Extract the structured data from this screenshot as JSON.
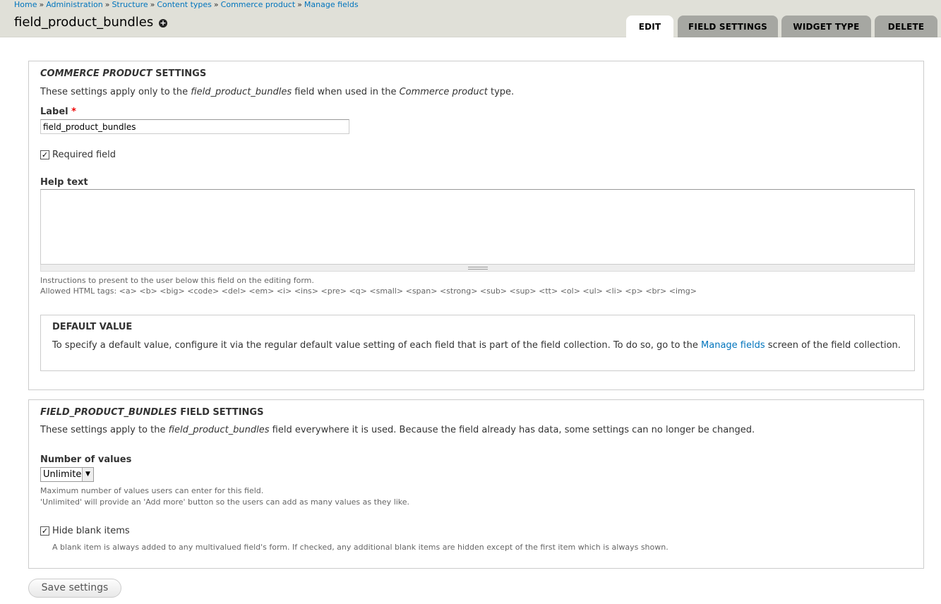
{
  "breadcrumb": [
    "Home",
    "Administration",
    "Structure",
    "Content types",
    "Commerce product",
    "Manage fields"
  ],
  "breadcrumb_sep": "»",
  "page_title": "field_product_bundles",
  "tabs": [
    "EDIT",
    "FIELD SETTINGS",
    "WIDGET TYPE",
    "DELETE"
  ],
  "instance_settings": {
    "legend_em": "COMMERCE PRODUCT",
    "legend_rest": " SETTINGS",
    "desc_1": "These settings apply only to the ",
    "desc_em1": "field_product_bundles",
    "desc_2": " field when used in the ",
    "desc_em2": "Commerce product",
    "desc_3": " type.",
    "label_title": "Label",
    "required_mark": "*",
    "label_value": "field_product_bundles",
    "required_field_label": "Required field",
    "required_checked": true,
    "help_text_title": "Help text",
    "help_text_value": "",
    "help_desc_1": "Instructions to present to the user below this field on the editing form.",
    "help_desc_2": "Allowed HTML tags: <a> <b> <big> <code> <del> <em> <i> <ins> <pre> <q> <small> <span> <strong> <sub> <sup> <tt> <ol> <ul> <li> <p> <br> <img>",
    "default_value": {
      "legend": "DEFAULT VALUE",
      "text_1": "To specify a default value, configure it via the regular default value setting of each field that is part of the field collection. To do so, go to the ",
      "link": "Manage fields",
      "text_2": " screen of the field collection."
    }
  },
  "field_settings": {
    "legend_em": "FIELD_PRODUCT_BUNDLES",
    "legend_rest": " FIELD SETTINGS",
    "desc_1": "These settings apply to the ",
    "desc_em": "field_product_bundles",
    "desc_2": " field everywhere it is used. Because the field already has data, some settings can no longer be changed.",
    "number_title": "Number of values",
    "number_value": "Unlimited",
    "number_desc_1": "Maximum number of values users can enter for this field.",
    "number_desc_2": "'Unlimited' will provide an 'Add more' button so the users can add as many values as they like.",
    "hide_blank_label": "Hide blank items",
    "hide_blank_checked": true,
    "hide_blank_desc": "A blank item is always added to any multivalued field's form. If checked, any additional blank items are hidden except of the first item which is always shown."
  },
  "save_label": "Save settings",
  "colors": {
    "link": "#0074bd",
    "header_bg": "#e0e0d8",
    "tab_bg": "#a6a7a2",
    "required": "#ee0000"
  },
  "icons": {
    "shortcut": "plus-circle-icon",
    "checkbox": "check-icon",
    "select_arrow": "triangle-down-icon"
  }
}
